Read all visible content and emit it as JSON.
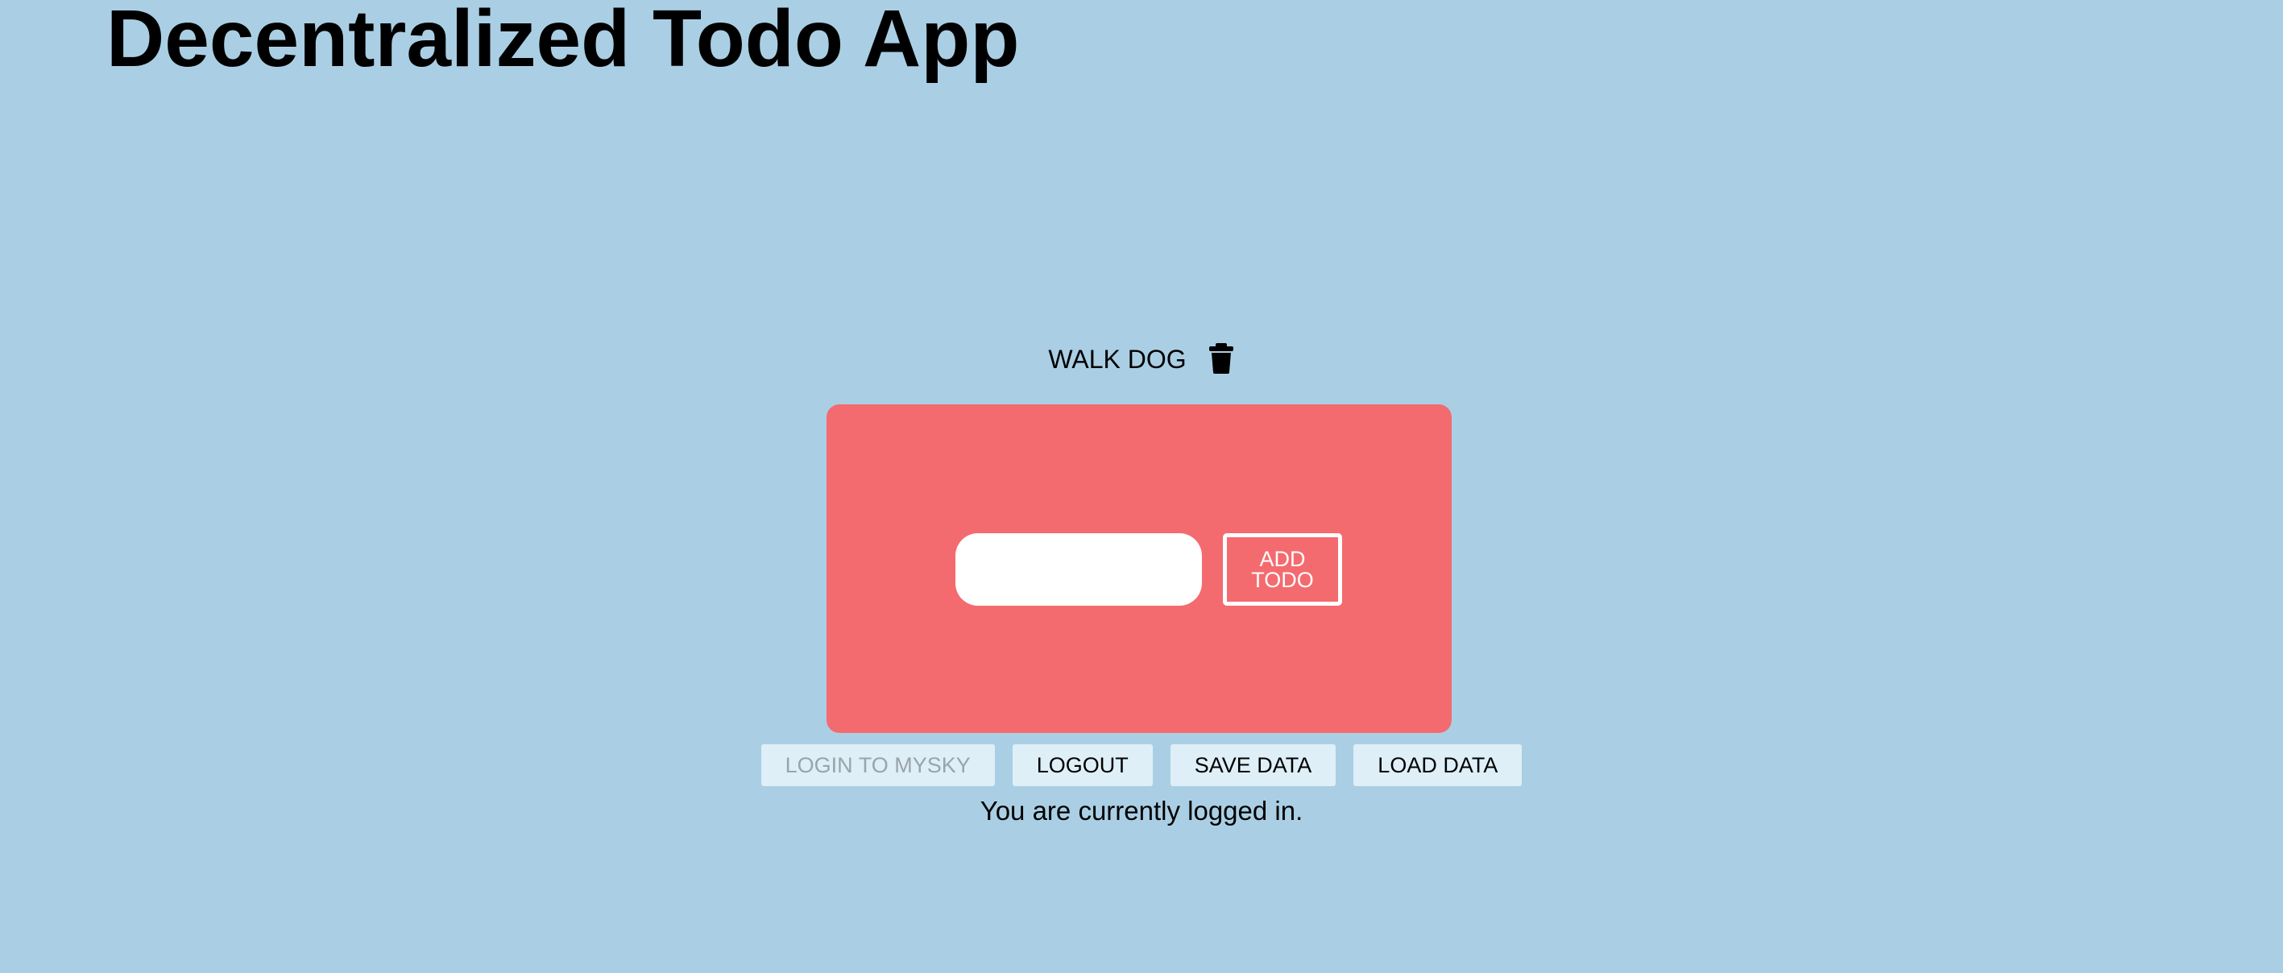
{
  "app": {
    "title": "Decentralized Todo App"
  },
  "todos": [
    {
      "text": "WALK DOG",
      "delete_icon": "trash-icon"
    }
  ],
  "add_form": {
    "input_value": "",
    "input_placeholder": "",
    "add_button_label": "ADD TODO"
  },
  "actions": {
    "login_label": "LOGIN TO MYSKY",
    "login_disabled": true,
    "logout_label": "LOGOUT",
    "save_label": "SAVE DATA",
    "load_label": "LOAD DATA"
  },
  "status": {
    "message": "You are currently logged in."
  },
  "colors": {
    "page_background": "#aacfe4",
    "card_background": "#f46b6f",
    "button_background": "#deeff8"
  }
}
